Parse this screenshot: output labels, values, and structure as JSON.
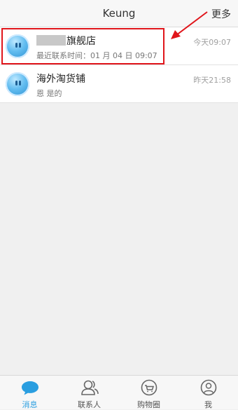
{
  "header": {
    "title": "Keung",
    "more_label": "更多"
  },
  "conversations": [
    {
      "name": "旗舰店",
      "name_redacted": true,
      "subtitle": "最近联系时间：01 月 04 日  09:07",
      "time": "今天09:07",
      "highlighted": true
    },
    {
      "name": "海外淘货铺",
      "name_redacted": false,
      "subtitle": "恩  是的",
      "time": "昨天21:58",
      "highlighted": false
    }
  ],
  "tabbar": {
    "tabs": [
      {
        "label": "消息",
        "icon": "chat-bubble-icon",
        "active": true
      },
      {
        "label": "联系人",
        "icon": "contacts-icon",
        "active": false
      },
      {
        "label": "购物圈",
        "icon": "shopping-circle-icon",
        "active": false
      },
      {
        "label": "我",
        "icon": "profile-icon",
        "active": false
      }
    ]
  },
  "colors": {
    "accent": "#2a9ee0",
    "annotation_red": "#e0151b",
    "background": "#f0f0f0"
  }
}
